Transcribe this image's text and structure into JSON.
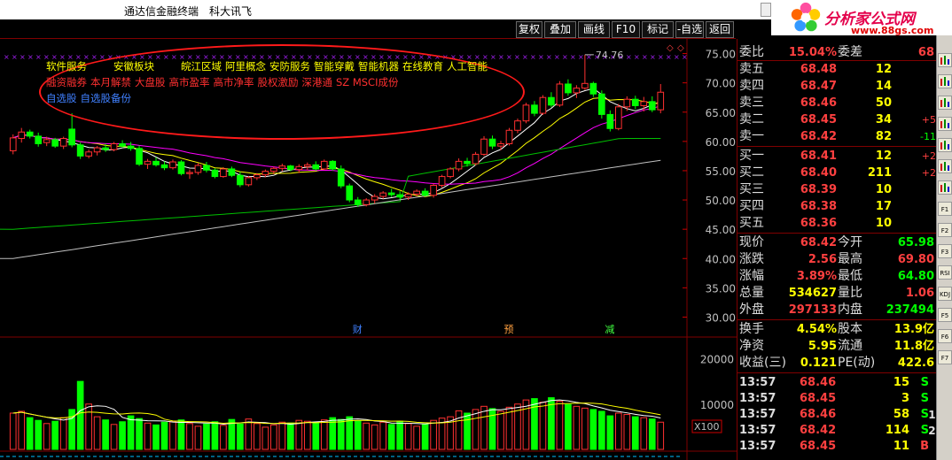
{
  "window": {
    "app_title": "通达信金融终端",
    "stock_name": "科大讯飞"
  },
  "logo": {
    "title": "分析家公式网",
    "url": "www.88gs.com"
  },
  "toolbar": {
    "buttons": [
      "复权",
      "叠加",
      "画线",
      "F10",
      "标记",
      "-自选",
      "返回"
    ]
  },
  "tags": {
    "row1": [
      "软件服务",
      "安徽板块",
      "皖江区域",
      "阿里概念",
      "安防服务",
      "智能穿戴",
      "智能机器",
      "在线教育",
      "人工智能"
    ],
    "row2": [
      "融资融券",
      "本月解禁",
      "大盘股",
      "高市盈率",
      "高市净率",
      "股权激励",
      "深港通",
      "SZ MSCI成份"
    ],
    "row3": [
      "自选股",
      "自选股备份"
    ]
  },
  "chart_data": {
    "type": "candlestick",
    "price_axis_ticks": [
      "75.00",
      "70.00",
      "65.00",
      "60.00",
      "55.00",
      "50.00",
      "45.00",
      "40.00",
      "35.00",
      "30.00"
    ],
    "ylim": [
      27.5,
      77.5
    ],
    "high_label": "74.76",
    "volume_axis_ticks": [
      "20000",
      "10000"
    ],
    "volume_unit": "X100",
    "event_markers": [
      {
        "label": "财",
        "index": 41
      },
      {
        "label": "预",
        "index": 59
      },
      {
        "label": "减",
        "index": 71
      }
    ],
    "candles": [
      [
        58.4,
        61.2,
        57.8,
        60.6
      ],
      [
        60.5,
        62.3,
        59.8,
        61.6
      ],
      [
        61.6,
        62.0,
        60.5,
        60.9
      ],
      [
        60.9,
        61.5,
        59.1,
        59.6
      ],
      [
        59.8,
        60.8,
        59.2,
        60.3
      ],
      [
        60.3,
        60.6,
        58.9,
        59.2
      ],
      [
        59.2,
        60.8,
        58.7,
        60.5
      ],
      [
        62.1,
        64.8,
        59.0,
        59.4
      ],
      [
        59.4,
        59.8,
        57.0,
        57.5
      ],
      [
        57.5,
        58.6,
        57.1,
        58.2
      ],
      [
        58.2,
        59.2,
        57.6,
        58.9
      ],
      [
        58.9,
        59.6,
        58.2,
        58.6
      ],
      [
        58.6,
        59.9,
        58.3,
        59.6
      ],
      [
        59.6,
        60.2,
        58.9,
        59.2
      ],
      [
        59.2,
        59.9,
        58.4,
        58.8
      ],
      [
        58.8,
        59.3,
        55.8,
        56.1
      ],
      [
        56.1,
        57.0,
        55.3,
        56.6
      ],
      [
        56.6,
        57.3,
        55.7,
        56.0
      ],
      [
        56.0,
        56.6,
        55.1,
        55.5
      ],
      [
        55.5,
        56.9,
        55.2,
        56.5
      ],
      [
        56.5,
        56.8,
        54.2,
        54.5
      ],
      [
        54.5,
        55.2,
        53.6,
        54.7
      ],
      [
        54.7,
        56.3,
        54.3,
        55.9
      ],
      [
        55.9,
        56.5,
        54.7,
        55.1
      ],
      [
        55.1,
        55.4,
        53.7,
        54.0
      ],
      [
        54.0,
        55.6,
        53.8,
        55.3
      ],
      [
        55.3,
        55.7,
        53.9,
        54.2
      ],
      [
        54.2,
        54.8,
        52.2,
        52.6
      ],
      [
        52.6,
        54.1,
        52.3,
        53.8
      ],
      [
        53.8,
        54.6,
        53.4,
        54.3
      ],
      [
        54.3,
        55.2,
        53.9,
        54.9
      ],
      [
        54.9,
        55.7,
        54.4,
        55.4
      ],
      [
        55.4,
        56.2,
        54.9,
        55.8
      ],
      [
        55.8,
        56.0,
        54.9,
        55.2
      ],
      [
        55.2,
        56.1,
        54.6,
        55.7
      ],
      [
        55.7,
        56.4,
        55.1,
        56.0
      ],
      [
        56.0,
        56.6,
        55.0,
        55.3
      ],
      [
        55.3,
        56.9,
        55.1,
        56.6
      ],
      [
        56.6,
        56.8,
        55.0,
        55.3
      ],
      [
        55.3,
        55.9,
        52.0,
        52.4
      ],
      [
        52.4,
        52.8,
        49.6,
        50.0
      ],
      [
        50.0,
        50.5,
        48.8,
        49.2
      ],
      [
        49.2,
        50.3,
        48.9,
        50.0
      ],
      [
        50.0,
        51.0,
        49.4,
        50.6
      ],
      [
        50.6,
        51.5,
        50.2,
        51.2
      ],
      [
        51.2,
        51.9,
        50.5,
        50.9
      ],
      [
        50.9,
        51.5,
        50.1,
        50.5
      ],
      [
        50.5,
        51.3,
        50.0,
        51.0
      ],
      [
        51.0,
        51.8,
        50.6,
        51.5
      ],
      [
        51.5,
        52.0,
        50.6,
        50.8
      ],
      [
        50.8,
        52.8,
        50.4,
        52.5
      ],
      [
        52.5,
        54.3,
        52.1,
        54.0
      ],
      [
        54.0,
        55.6,
        53.7,
        55.3
      ],
      [
        55.3,
        57.1,
        54.9,
        56.6
      ],
      [
        56.6,
        57.2,
        55.7,
        56.2
      ],
      [
        56.2,
        58.2,
        55.9,
        57.8
      ],
      [
        57.8,
        60.9,
        57.5,
        60.4
      ],
      [
        60.4,
        61.0,
        58.7,
        59.2
      ],
      [
        59.2,
        60.1,
        58.5,
        59.6
      ],
      [
        59.6,
        62.3,
        59.3,
        61.9
      ],
      [
        61.9,
        63.9,
        61.4,
        63.5
      ],
      [
        63.5,
        66.6,
        63.1,
        66.2
      ],
      [
        66.2,
        66.9,
        64.3,
        64.8
      ],
      [
        64.8,
        67.9,
        64.5,
        67.5
      ],
      [
        67.5,
        68.4,
        65.8,
        66.2
      ],
      [
        66.2,
        70.3,
        65.9,
        69.8
      ],
      [
        69.8,
        70.6,
        67.8,
        68.3
      ],
      [
        68.3,
        69.6,
        67.4,
        69.1
      ],
      [
        69.1,
        74.8,
        68.8,
        69.9
      ],
      [
        69.9,
        70.2,
        67.6,
        68.1
      ],
      [
        68.1,
        68.7,
        63.9,
        64.6
      ],
      [
        64.6,
        65.3,
        61.7,
        62.2
      ],
      [
        62.2,
        66.4,
        61.9,
        65.9
      ],
      [
        65.9,
        67.7,
        65.2,
        67.2
      ],
      [
        67.2,
        67.8,
        65.5,
        66.1
      ],
      [
        66.1,
        67.6,
        65.1,
        66.8
      ],
      [
        66.8,
        67.7,
        65.0,
        65.4
      ],
      [
        65.4,
        69.8,
        64.8,
        68.4
      ]
    ],
    "volumes": [
      80,
      84,
      70,
      64,
      57,
      62,
      70,
      88,
      150,
      100,
      72,
      65,
      55,
      61,
      74,
      68,
      58,
      54,
      60,
      61,
      65,
      57,
      51,
      56,
      61,
      53,
      66,
      56,
      67,
      57,
      49,
      54,
      60,
      58,
      64,
      62,
      60,
      65,
      70,
      66,
      72,
      63,
      58,
      54,
      60,
      55,
      62,
      57,
      51,
      56,
      64,
      69,
      72,
      85,
      80,
      88,
      95,
      90,
      84,
      93,
      100,
      109,
      112,
      104,
      114,
      106,
      99,
      95,
      91,
      88,
      84,
      74,
      80,
      77,
      72,
      70,
      67,
      60
    ],
    "volume_ylim": [
      0,
      24000
    ]
  },
  "quote": {
    "ratio_label": "委比",
    "ratio": "15.04%",
    "diff_label": "委差",
    "diff": "68",
    "asks": [
      {
        "label": "卖五",
        "price": "68.48",
        "vol": "12",
        "chg": ""
      },
      {
        "label": "卖四",
        "price": "68.47",
        "vol": "14",
        "chg": ""
      },
      {
        "label": "卖三",
        "price": "68.46",
        "vol": "50",
        "chg": ""
      },
      {
        "label": "卖二",
        "price": "68.45",
        "vol": "34",
        "chg": "+5"
      },
      {
        "label": "卖一",
        "price": "68.42",
        "vol": "82",
        "chg": "-11"
      }
    ],
    "bids": [
      {
        "label": "买一",
        "price": "68.41",
        "vol": "12",
        "chg": "+2"
      },
      {
        "label": "买二",
        "price": "68.40",
        "vol": "211",
        "chg": "+2"
      },
      {
        "label": "买三",
        "price": "68.39",
        "vol": "10",
        "chg": ""
      },
      {
        "label": "买四",
        "price": "68.38",
        "vol": "17",
        "chg": ""
      },
      {
        "label": "买五",
        "price": "68.36",
        "vol": "10",
        "chg": ""
      }
    ],
    "stats": [
      {
        "l1": "现价",
        "v1": "68.42",
        "c1": "#ff4040",
        "l2": "今开",
        "v2": "65.98",
        "c2": "#00ff00"
      },
      {
        "l1": "涨跌",
        "v1": "2.56",
        "c1": "#ff4040",
        "l2": "最高",
        "v2": "69.80",
        "c2": "#ff4040"
      },
      {
        "l1": "涨幅",
        "v1": "3.89%",
        "c1": "#ff4040",
        "l2": "最低",
        "v2": "64.80",
        "c2": "#00ff00"
      },
      {
        "l1": "总量",
        "v1": "534627",
        "c1": "#ffff00",
        "l2": "量比",
        "v2": "1.06",
        "c2": "#ff4040"
      },
      {
        "l1": "外盘",
        "v1": "297133",
        "c1": "#ff4040",
        "l2": "内盘",
        "v2": "237494",
        "c2": "#00ff00"
      }
    ],
    "stats2": [
      {
        "l1": "换手",
        "v1": "4.54%",
        "c1": "#ffff00",
        "l2": "股本",
        "v2": "13.9亿",
        "c2": "#ffff00"
      },
      {
        "l1": "净资",
        "v1": "5.95",
        "c1": "#ffff00",
        "l2": "流通",
        "v2": "11.8亿",
        "c2": "#ffff00"
      },
      {
        "l1": "收益(三)",
        "v1": "0.121",
        "c1": "#ffff00",
        "l2": "PE(动)",
        "v2": "422.6",
        "c2": "#ffff00"
      }
    ],
    "ticks": [
      {
        "time": "13:57",
        "price": "68.46",
        "vol": "15",
        "bs": "S",
        "bsc": "#00ff00",
        "n": "6"
      },
      {
        "time": "13:57",
        "price": "68.45",
        "vol": "3",
        "bs": "S",
        "bsc": "#00ff00",
        "n": "3"
      },
      {
        "time": "13:57",
        "price": "68.46",
        "vol": "58",
        "bs": "S",
        "bsc": "#00ff00",
        "n": "12"
      },
      {
        "time": "13:57",
        "price": "68.42",
        "vol": "114",
        "bs": "S",
        "bsc": "#00ff00",
        "n": "27"
      },
      {
        "time": "13:57",
        "price": "68.45",
        "vol": "11",
        "bs": "B",
        "bsc": "#ff4040",
        "n": "5"
      }
    ]
  },
  "side_icons": [
    "gear",
    "chart",
    "list",
    "k-line",
    "grid",
    "bar",
    "line",
    "F1",
    "F2",
    "F3",
    "RSI",
    "KDJ",
    "F5",
    "F6",
    "F7"
  ]
}
